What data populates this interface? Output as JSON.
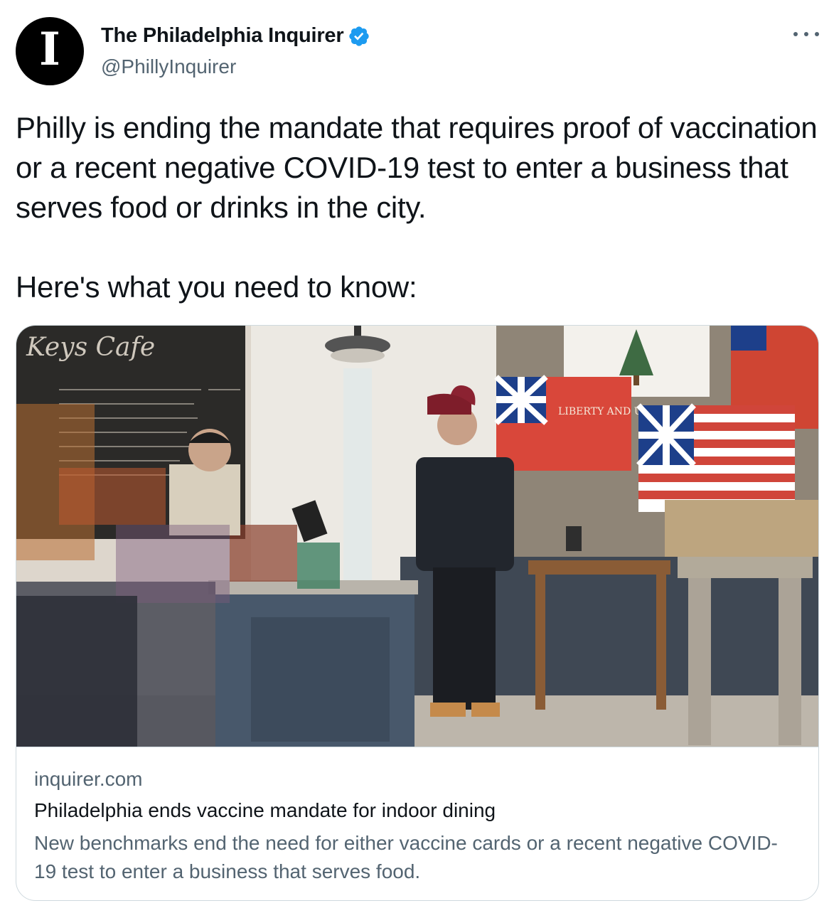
{
  "tweet": {
    "author": {
      "display_name": "The Philadelphia Inquirer",
      "handle": "@PhillyInquirer",
      "avatar_letter": "I",
      "verified": true,
      "verified_color": "#1d9bf0"
    },
    "more_icon": "more-horizontal-icon",
    "text_paragraphs": [
      "Philly is ending the mandate that requires proof of vaccination or a recent negative COVID-19 test to enter a business that serves food or drinks in the city.",
      "Here's what you need to know:"
    ]
  },
  "card": {
    "image_sign_text": "Keys Cafe",
    "image_flag_text": "LIBERTY AND UNION",
    "domain": "inquirer.com",
    "title": "Philadelphia ends vaccine mandate for indoor dining",
    "description": "New benchmarks end the need for either vaccine cards or a recent negative COVID-19 test to enter a business that serves food."
  },
  "colors": {
    "text_primary": "#0f1419",
    "text_secondary": "#536471",
    "border": "#cfd9de"
  }
}
